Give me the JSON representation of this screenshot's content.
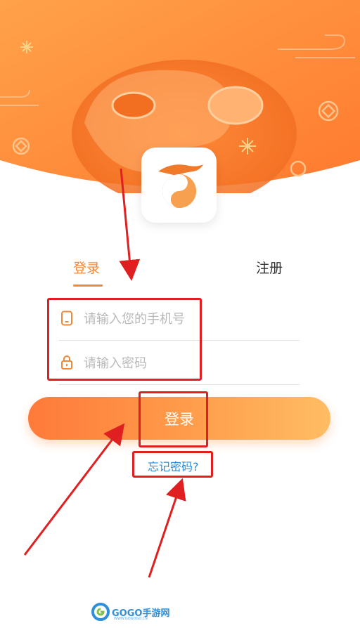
{
  "tabs": [
    {
      "label": "登录",
      "active": true
    },
    {
      "label": "注册",
      "active": false
    }
  ],
  "form": {
    "phone_placeholder": "请输入您的手机号",
    "password_placeholder": "请输入密码"
  },
  "login_button": "登录",
  "forgot_password": "忘记密码?",
  "watermark": {
    "brand": "GOGO手游网",
    "url": "WWW.GOGOGO.CN"
  },
  "colors": {
    "accent": "#f0893a",
    "button_start": "#ff7a3a",
    "button_end": "#ffbd63",
    "link": "#2a8ad6",
    "annotation": "#e02020"
  },
  "icons": [
    "app-logo-icon",
    "phone-icon",
    "lock-icon"
  ]
}
